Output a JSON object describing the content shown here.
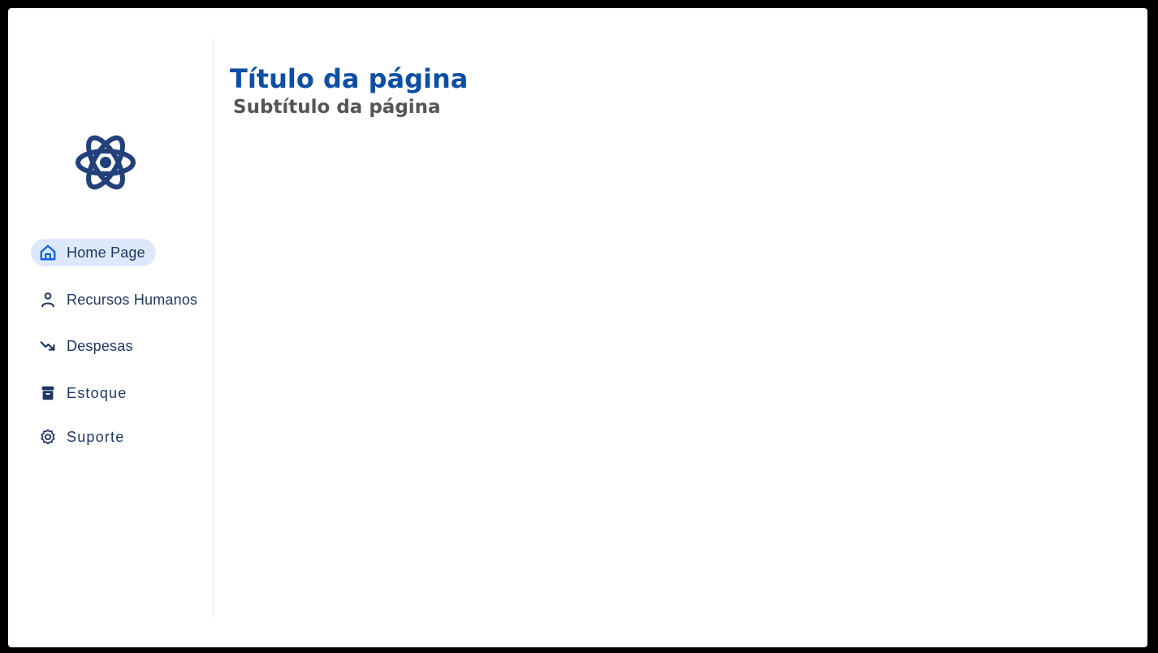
{
  "page": {
    "title": "Título da página",
    "subtitle": "Subtítulo da página"
  },
  "logo": {
    "icon": "atom-icon",
    "color": "#22407a"
  },
  "sidebar": {
    "items": [
      {
        "label": "Home Page",
        "icon": "home-icon",
        "active": true
      },
      {
        "label": "Recursos Humanos",
        "icon": "user-icon",
        "active": false
      },
      {
        "label": "Despesas",
        "icon": "trending-down-icon",
        "active": false
      },
      {
        "label": "Estoque",
        "icon": "archive-box-icon",
        "active": false
      },
      {
        "label": "Suporte",
        "icon": "gear-icon",
        "active": false
      }
    ]
  },
  "colors": {
    "title": "#0d4ea6",
    "subtitle": "#555555",
    "nav_text": "#1f3664",
    "active_icon": "#1565e0",
    "active_bg": "#dde9fb",
    "frame": "#000000"
  }
}
